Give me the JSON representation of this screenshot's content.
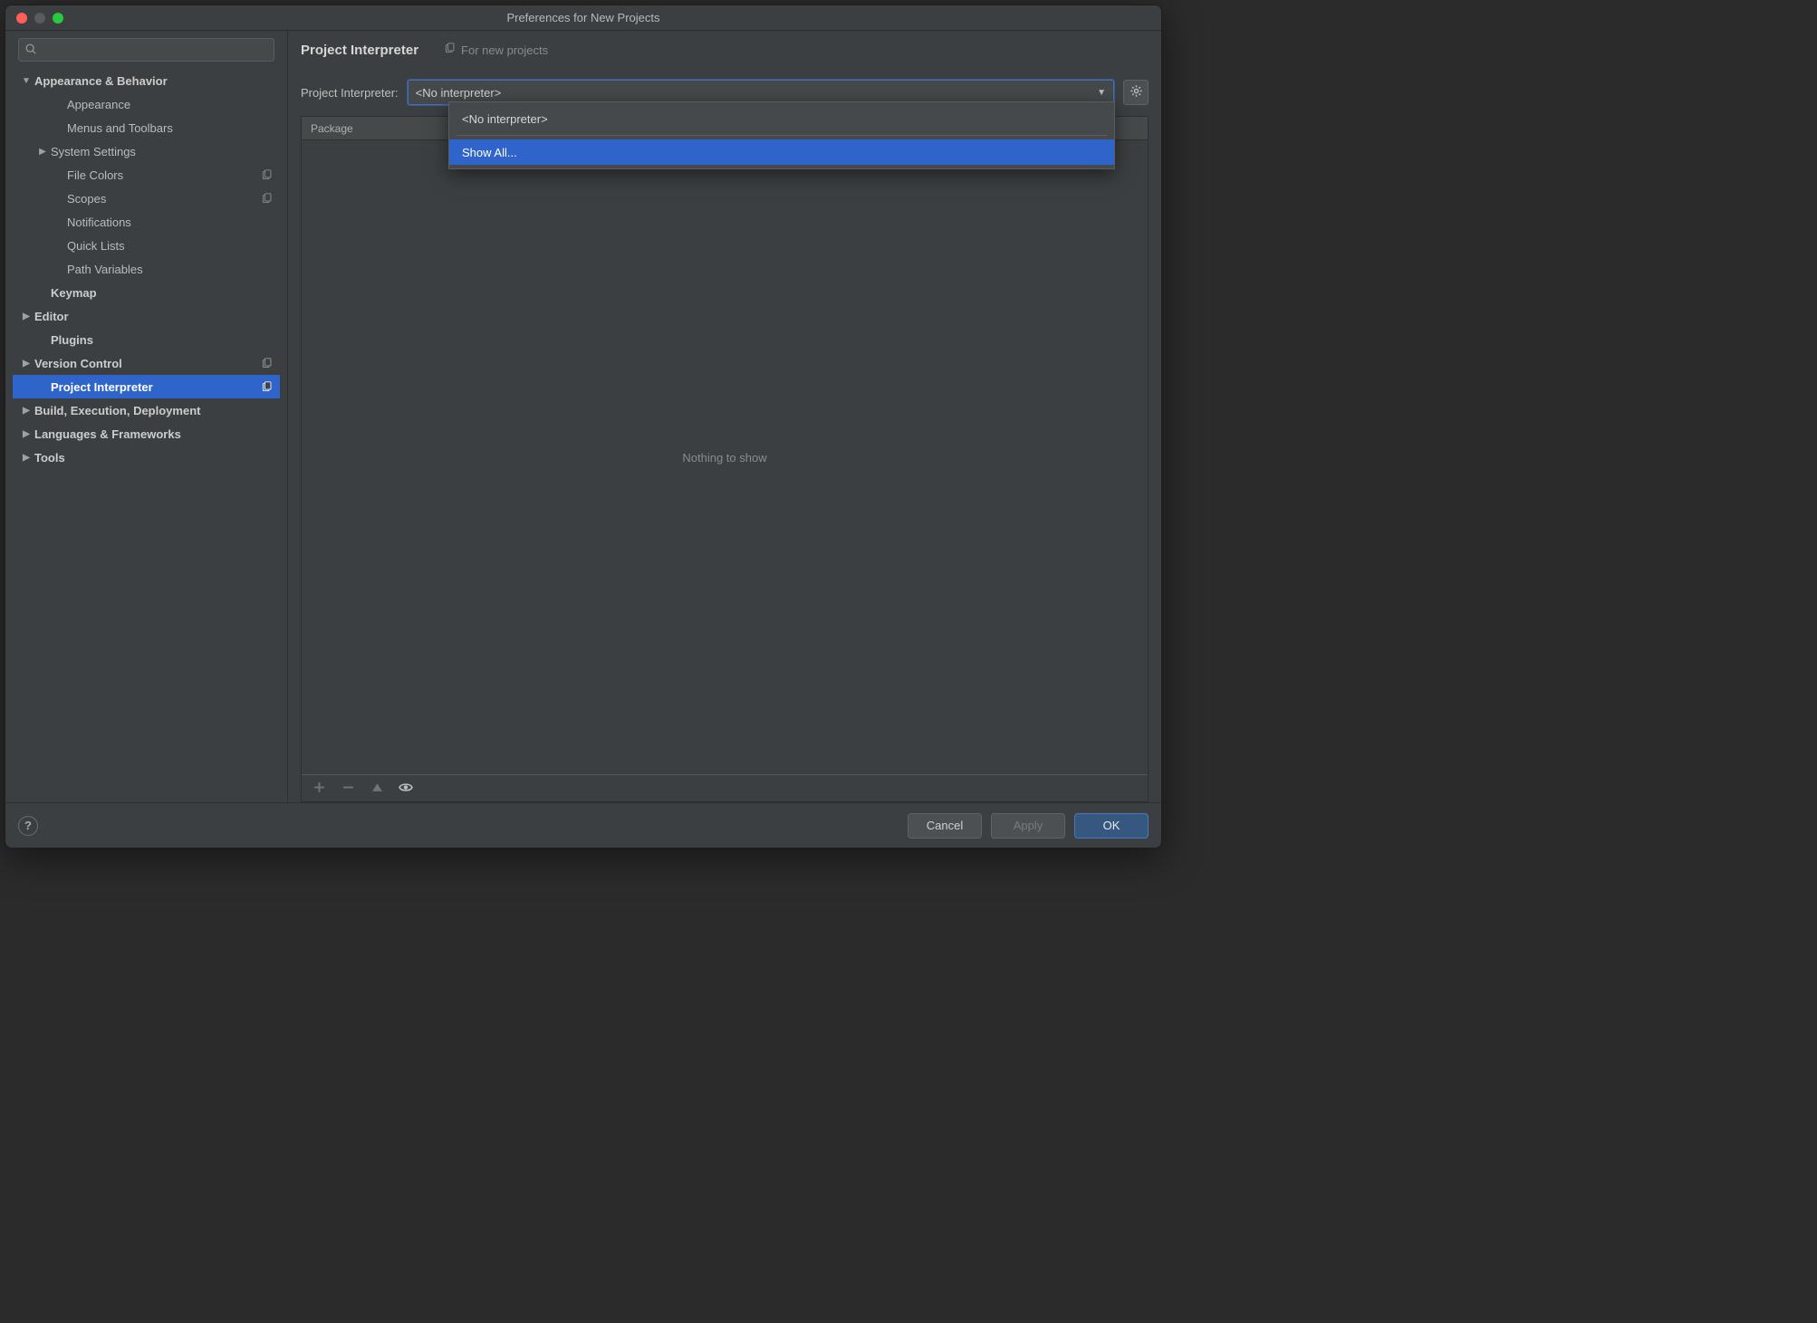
{
  "window": {
    "title": "Preferences for New Projects"
  },
  "sidebar": {
    "search_placeholder": "",
    "items": [
      {
        "label": "Appearance & Behavior",
        "indent": 0,
        "bold": true,
        "arrow": "down",
        "copy": false
      },
      {
        "label": "Appearance",
        "indent": 2,
        "bold": false,
        "arrow": "",
        "copy": false
      },
      {
        "label": "Menus and Toolbars",
        "indent": 2,
        "bold": false,
        "arrow": "",
        "copy": false
      },
      {
        "label": "System Settings",
        "indent": 1,
        "bold": false,
        "arrow": "right",
        "copy": false
      },
      {
        "label": "File Colors",
        "indent": 2,
        "bold": false,
        "arrow": "",
        "copy": true
      },
      {
        "label": "Scopes",
        "indent": 2,
        "bold": false,
        "arrow": "",
        "copy": true
      },
      {
        "label": "Notifications",
        "indent": 2,
        "bold": false,
        "arrow": "",
        "copy": false
      },
      {
        "label": "Quick Lists",
        "indent": 2,
        "bold": false,
        "arrow": "",
        "copy": false
      },
      {
        "label": "Path Variables",
        "indent": 2,
        "bold": false,
        "arrow": "",
        "copy": false
      },
      {
        "label": "Keymap",
        "indent": 1,
        "bold": true,
        "arrow": "",
        "copy": false
      },
      {
        "label": "Editor",
        "indent": 0,
        "bold": true,
        "arrow": "right",
        "copy": false
      },
      {
        "label": "Plugins",
        "indent": 1,
        "bold": true,
        "arrow": "",
        "copy": false
      },
      {
        "label": "Version Control",
        "indent": 0,
        "bold": true,
        "arrow": "right",
        "copy": true
      },
      {
        "label": "Project Interpreter",
        "indent": 1,
        "bold": true,
        "arrow": "",
        "copy": true,
        "selected": true
      },
      {
        "label": "Build, Execution, Deployment",
        "indent": 0,
        "bold": true,
        "arrow": "right",
        "copy": false
      },
      {
        "label": "Languages & Frameworks",
        "indent": 0,
        "bold": true,
        "arrow": "right",
        "copy": false
      },
      {
        "label": "Tools",
        "indent": 0,
        "bold": true,
        "arrow": "right",
        "copy": false
      }
    ]
  },
  "main": {
    "title": "Project Interpreter",
    "for_new_label": "For new projects",
    "interpreter_label": "Project Interpreter:",
    "interpreter_value": "<No interpreter>",
    "table": {
      "header_package": "Package",
      "empty_text": "Nothing to show"
    },
    "dropdown": {
      "option_no_interpreter": "<No interpreter>",
      "option_show_all": "Show All..."
    }
  },
  "footer": {
    "cancel": "Cancel",
    "apply": "Apply",
    "ok": "OK"
  }
}
